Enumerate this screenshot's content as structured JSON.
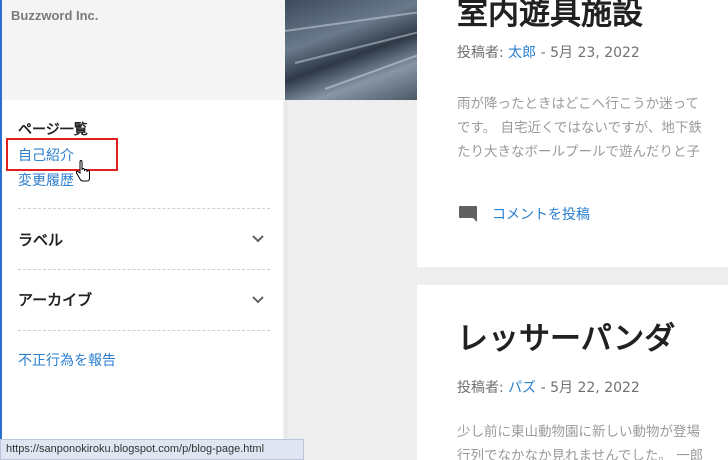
{
  "sidebar": {
    "brand": "Buzzword Inc.",
    "pages_title": "ページ一覧",
    "page_links": [
      "自己紹介",
      "変更履歴"
    ],
    "sections": [
      {
        "label": "ラベル",
        "icon": "chevron-down-icon"
      },
      {
        "label": "アーカイブ",
        "icon": "chevron-down-icon"
      }
    ],
    "report_link": "不正行為を報告"
  },
  "status_bar": {
    "url": "https://sanponokiroku.blogspot.com/p/blog-page.html"
  },
  "posts": [
    {
      "title": "室内遊具施設",
      "meta_prefix": "投稿者: ",
      "author": "太郎",
      "date": " - 5月 23, 2022",
      "excerpt_lines": [
        " 雨が降ったときはどこへ行こうか迷って",
        "です。 自宅近くではないですが、地下鉄",
        "たり大きなボールプールで遊んだりと子"
      ],
      "comment_label": "コメントを投稿"
    },
    {
      "title": "レッサーパンダ",
      "meta_prefix": "投稿者: ",
      "author": "パズ",
      "date": " - 5月 22, 2022",
      "excerpt_lines": [
        "少し前に東山動物園に新しい動物が登場",
        "行列でなかなか見れませんでした。 一郎"
      ]
    }
  ],
  "colors": {
    "link": "#2b7fcf",
    "highlight": "#e02020",
    "background": "#eeeeee"
  }
}
